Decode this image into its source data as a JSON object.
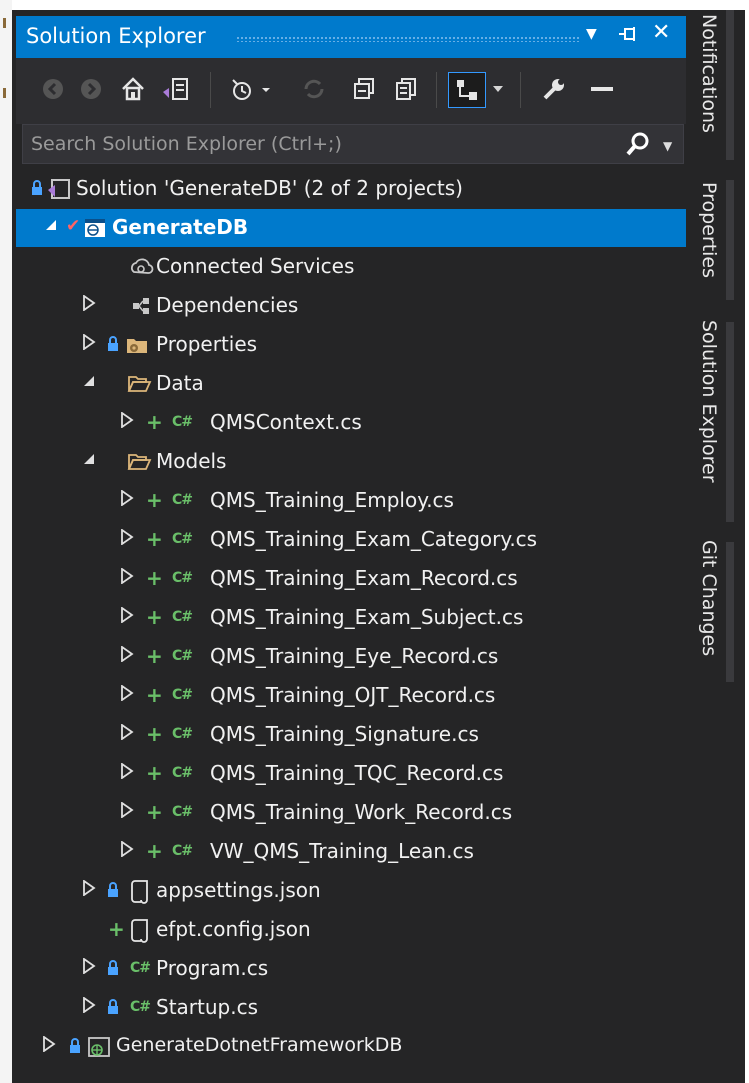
{
  "window": {
    "title": "Solution Explorer"
  },
  "title_buttons": {
    "dropdown_icon": "▼",
    "pin_icon": "⊣",
    "close_icon": "✕"
  },
  "search": {
    "placeholder": "Search Solution Explorer (Ctrl+;)"
  },
  "toolbar": {
    "buttons": [
      "back-icon",
      "forward-icon",
      "home-icon",
      "switch-views-icon",
      "pending-changes-icon",
      "sync-icon",
      "collapse-all-icon",
      "show-all-files-icon",
      "sync-with-active-document-icon",
      "properties-icon",
      "preview-selected-items-icon"
    ]
  },
  "tree": {
    "solution": "Solution 'GenerateDB' (2 of 2 projects)",
    "project": "GenerateDB",
    "connected_services": "Connected Services",
    "dependencies": "Dependencies",
    "properties": "Properties",
    "data_folder": "Data",
    "qms_context": "QMSContext.cs",
    "models_folder": "Models",
    "models": [
      "QMS_Training_Employ.cs",
      "QMS_Training_Exam_Category.cs",
      "QMS_Training_Exam_Record.cs",
      "QMS_Training_Exam_Subject.cs",
      "QMS_Training_Eye_Record.cs",
      "QMS_Training_OJT_Record.cs",
      "QMS_Training_Signature.cs",
      "QMS_Training_TQC_Record.cs",
      "QMS_Training_Work_Record.cs",
      "VW_QMS_Training_Lean.cs"
    ],
    "appsettings": "appsettings.json",
    "efpt": "efpt.config.json",
    "program": "Program.cs",
    "startup": "Startup.cs",
    "second_project": "GenerateDotnetFrameworkDB"
  },
  "cs_label": "C#",
  "side_tabs": [
    "Notifications",
    "Properties",
    "Solution Explorer",
    "Git Changes"
  ],
  "colors": {
    "accent": "#007acc",
    "background": "#252526",
    "added": "#6abf69",
    "text": "#f1f1f1"
  }
}
